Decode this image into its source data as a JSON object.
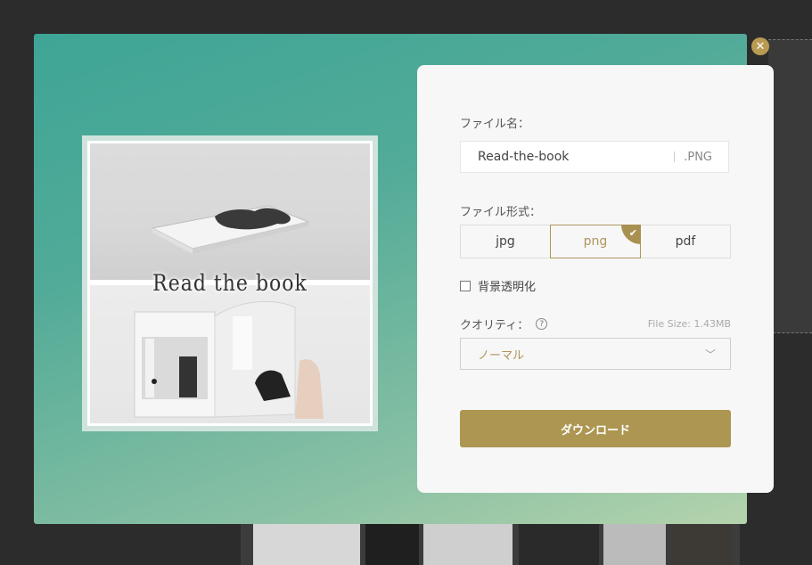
{
  "dialog": {
    "close_icon": "close-icon"
  },
  "preview": {
    "title": "Read the book"
  },
  "form": {
    "filename_label": "ファイル名：",
    "filename_value": "Read-the-book",
    "filename_ext": ".PNG",
    "format_label": "ファイル形式：",
    "formats": [
      {
        "label": "jpg",
        "selected": false
      },
      {
        "label": "png",
        "selected": true
      },
      {
        "label": "pdf",
        "selected": false
      }
    ],
    "transparent_label": "背景透明化",
    "transparent_checked": false,
    "quality_label": "クオリティ：",
    "help_icon": "question-icon",
    "file_size": "File Size: 1.43MB",
    "quality_value": "ノーマル",
    "download_label": "ダウンロード"
  },
  "colors": {
    "accent": "#ad9651",
    "gradient_start": "#3ea596",
    "gradient_end": "#b4d3ac"
  }
}
